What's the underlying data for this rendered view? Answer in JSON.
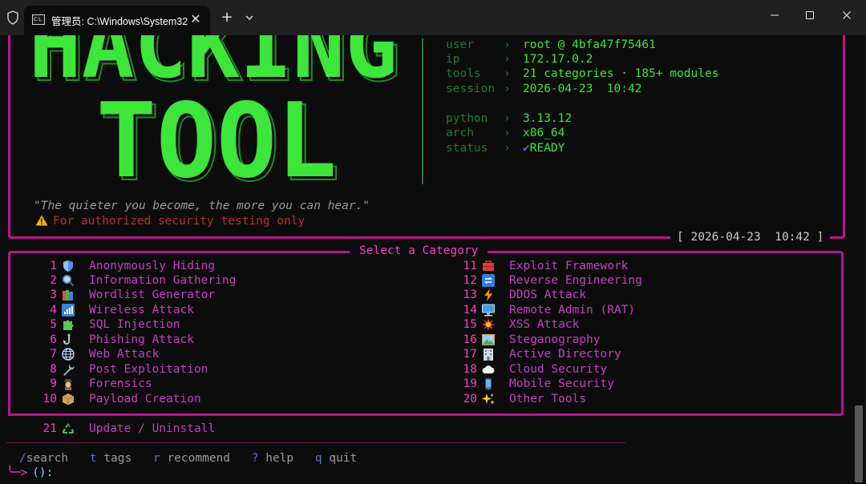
{
  "window": {
    "tab_title": "管理员: C:\\Windows\\System32",
    "tab_icon_text": "C:\\."
  },
  "logo": {
    "line1": "HACKING",
    "line2": "TOOL",
    "color": "#3ee53a"
  },
  "info": [
    {
      "key": "user",
      "arrow": "›",
      "value": "root @ 4bfa47f75461"
    },
    {
      "key": "ip",
      "arrow": "›",
      "value": "172.17.0.2"
    },
    {
      "key": "tools",
      "arrow": "›",
      "value": "21 categories · 185+ modules"
    },
    {
      "key": "session",
      "arrow": "›",
      "value": "2026-04-23  10:42"
    },
    {
      "key": "python",
      "arrow": "›",
      "value": "3.13.12"
    },
    {
      "key": "arch",
      "arrow": "›",
      "value": "x86_64"
    },
    {
      "key": "status",
      "arrow": "›",
      "value_check": "✔",
      "value": "READY"
    }
  ],
  "quote": "\"The quieter you become, the more you can hear.\"",
  "warning": "For authorized security testing only",
  "clock": "[ 2026-04-23  10:42 ]",
  "menu": {
    "title": "Select a Category",
    "left": [
      {
        "num": "1",
        "icon": "shield-icon",
        "label": "Anonymously Hiding"
      },
      {
        "num": "2",
        "icon": "magnifier-icon",
        "label": "Information Gathering"
      },
      {
        "num": "3",
        "icon": "books-icon",
        "label": "Wordlist Generator"
      },
      {
        "num": "4",
        "icon": "signal-bars-icon",
        "label": "Wireless Attack"
      },
      {
        "num": "5",
        "icon": "puzzle-icon",
        "label": "SQL Injection"
      },
      {
        "num": "6",
        "icon": "hook-icon",
        "label": "Phishing Attack"
      },
      {
        "num": "7",
        "icon": "globe-icon",
        "label": "Web Attack"
      },
      {
        "num": "8",
        "icon": "wrench-icon",
        "label": "Post Exploitation"
      },
      {
        "num": "9",
        "icon": "detective-icon",
        "label": "Forensics"
      },
      {
        "num": "10",
        "icon": "package-icon",
        "label": "Payload Creation"
      }
    ],
    "right": [
      {
        "num": "11",
        "icon": "toolbox-icon",
        "label": "Exploit Framework"
      },
      {
        "num": "12",
        "icon": "repeat-icon",
        "label": "Reverse Engineering"
      },
      {
        "num": "13",
        "icon": "lightning-icon",
        "label": "DDOS Attack"
      },
      {
        "num": "14",
        "icon": "monitor-icon",
        "label": "Remote Admin (RAT)"
      },
      {
        "num": "15",
        "icon": "explosion-icon",
        "label": "XSS Attack"
      },
      {
        "num": "16",
        "icon": "picture-icon",
        "label": "Steganography"
      },
      {
        "num": "17",
        "icon": "building-icon",
        "label": "Active Directory"
      },
      {
        "num": "18",
        "icon": "cloud-icon",
        "label": "Cloud Security"
      },
      {
        "num": "19",
        "icon": "phone-icon",
        "label": "Mobile Security"
      },
      {
        "num": "20",
        "icon": "sparkles-icon",
        "label": "Other Tools"
      }
    ],
    "update": {
      "num": "21",
      "icon": "recycle-icon",
      "label": "Update / Uninstall"
    }
  },
  "help": [
    {
      "key": "/",
      "text": "search"
    },
    {
      "key": "t",
      "text": "tags"
    },
    {
      "key": "r",
      "text": "recommend"
    },
    {
      "key": "?",
      "text": "help"
    },
    {
      "key": "q",
      "text": "quit"
    }
  ],
  "prompt": {
    "arrow": "╰─>",
    "text": "():"
  },
  "colors": {
    "accent": "#b8158f",
    "label": "#c53fc4",
    "number": "#ff3ac8",
    "green": "#3ee53a",
    "dim_green": "#1f7a34"
  }
}
